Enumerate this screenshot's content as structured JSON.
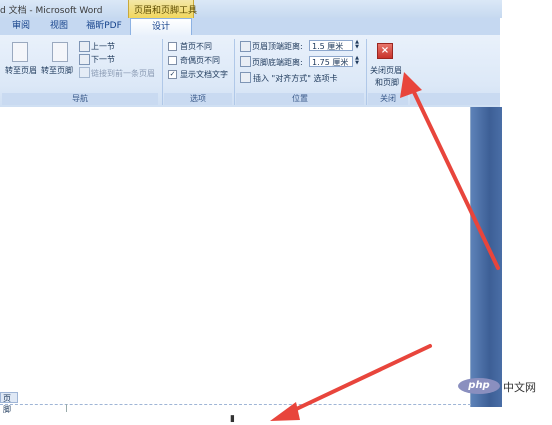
{
  "window": {
    "title": "d 文档 - Microsoft Word",
    "context_tab_group": "页眉和页脚工具"
  },
  "tabs": [
    {
      "label": "审阅"
    },
    {
      "label": "视图"
    },
    {
      "label": "福昕PDF"
    },
    {
      "label": "设计",
      "active": true
    }
  ],
  "ribbon": {
    "navigation": {
      "goto_header": "转至页眉",
      "goto_footer": "转至页脚",
      "prev_section": "上一节",
      "next_section": "下一节",
      "link_previous": "链接到前一条页眉",
      "group_label": "导航"
    },
    "options": {
      "different_first_page": {
        "label": "首页不同",
        "checked": false
      },
      "different_odd_even": {
        "label": "奇偶页不同",
        "checked": false
      },
      "show_document_text": {
        "label": "显示文档文字",
        "checked": true
      },
      "group_label": "选项"
    },
    "position": {
      "header_distance_label": "页眉顶端距离:",
      "header_distance_value": "1.5 厘米",
      "footer_distance_label": "页脚底端距离:",
      "footer_distance_value": "1.75 厘米",
      "insert_alignment_tab": "插入 \"对齐方式\" 选项卡",
      "group_label": "位置"
    },
    "close": {
      "close_button_line1": "关闭页眉",
      "close_button_line2": "和页脚",
      "group_label": "关闭"
    }
  },
  "document": {
    "footer_tab_label": "页脚"
  },
  "watermark": {
    "logo": "php",
    "text": "中文网"
  },
  "colors": {
    "annotation_arrow": "#e8453c",
    "ribbon_bg": "#dce8f7",
    "context_tab": "#f1d75e",
    "scroll_pane": "#3d5f96"
  }
}
